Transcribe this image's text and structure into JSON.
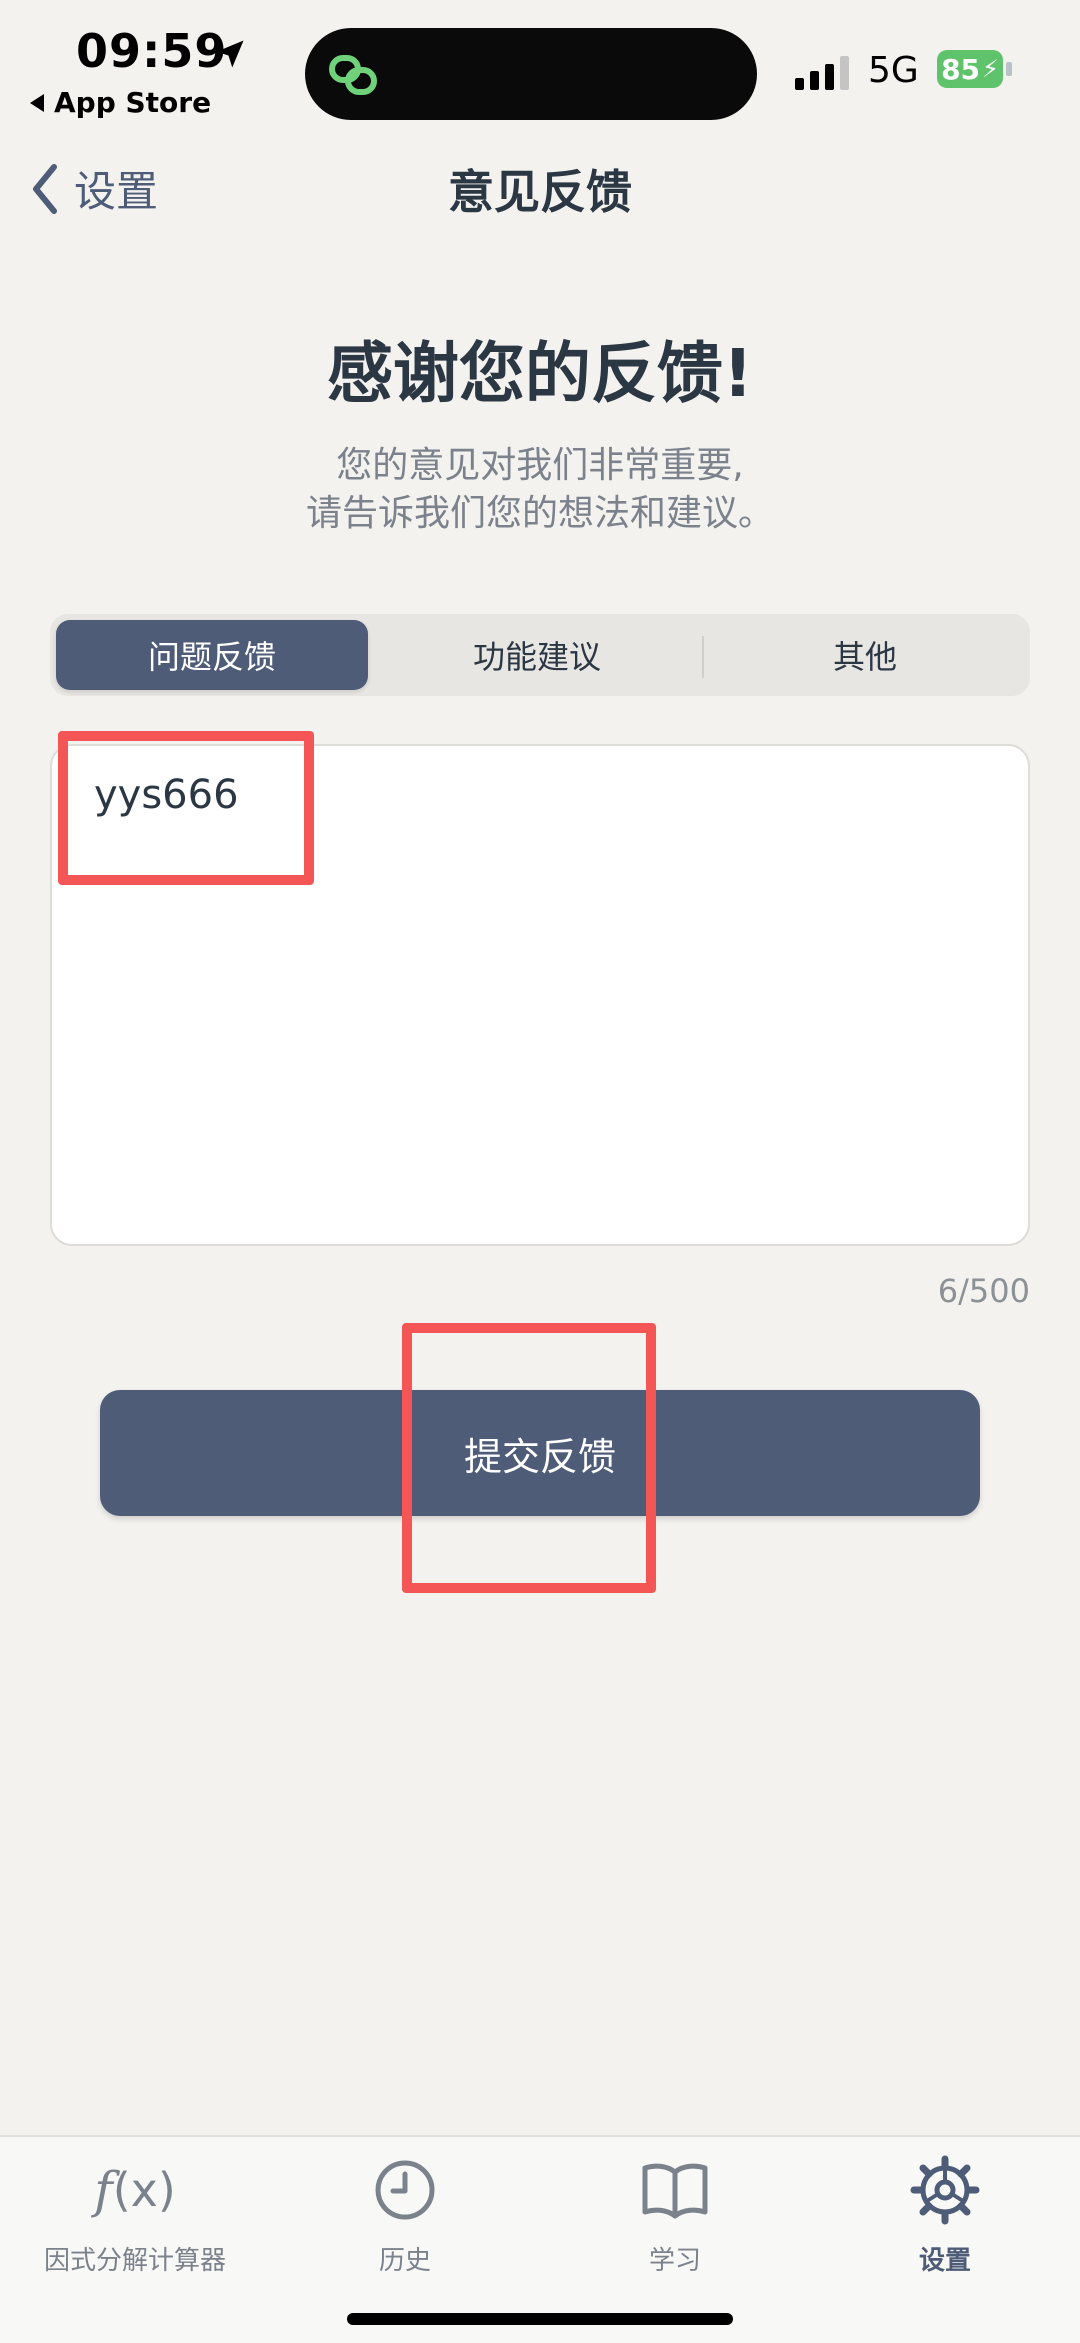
{
  "status_bar": {
    "time": "09:59",
    "back_app": "App Store",
    "network": "5G",
    "battery": "85"
  },
  "nav": {
    "back_label": "设置",
    "title": "意见反馈"
  },
  "header": {
    "headline": "感谢您的反馈!",
    "subtitle_line1": "您的意见对我们非常重要,",
    "subtitle_line2": "请告诉我们您的想法和建议。"
  },
  "segments": [
    {
      "label": "问题反馈",
      "selected": true
    },
    {
      "label": "功能建议",
      "selected": false
    },
    {
      "label": "其他",
      "selected": false
    }
  ],
  "feedback": {
    "value": "yys666",
    "count": "6/500"
  },
  "submit_label": "提交反馈",
  "tabs": [
    {
      "label": "因式分解计算器",
      "icon": "fx-icon"
    },
    {
      "label": "历史",
      "icon": "clock-icon"
    },
    {
      "label": "学习",
      "icon": "book-icon"
    },
    {
      "label": "设置",
      "icon": "gear-icon",
      "active": true
    }
  ],
  "colors": {
    "accent": "#4e5c78",
    "background": "#f3f2ef",
    "highlight": "#f45655",
    "battery": "#5fc36b"
  }
}
